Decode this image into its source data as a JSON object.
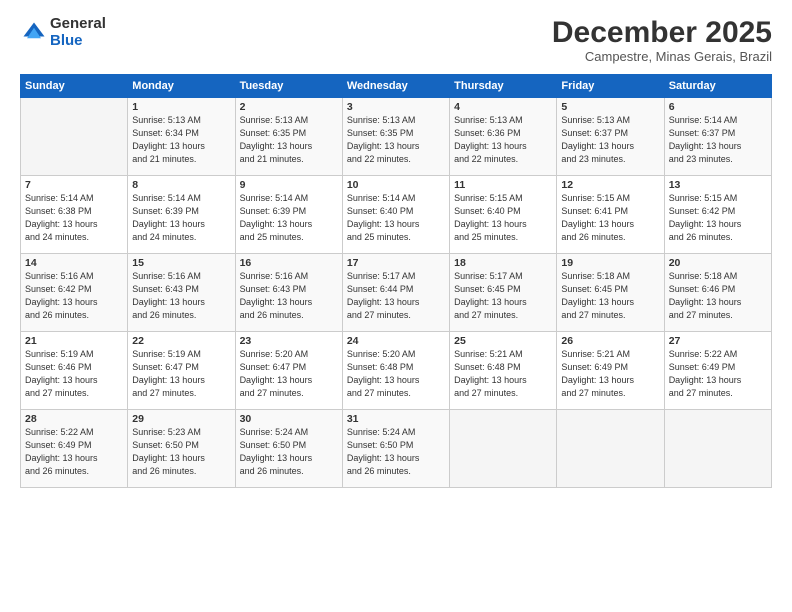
{
  "header": {
    "logo_general": "General",
    "logo_blue": "Blue",
    "month_title": "December 2025",
    "location": "Campestre, Minas Gerais, Brazil"
  },
  "days_of_week": [
    "Sunday",
    "Monday",
    "Tuesday",
    "Wednesday",
    "Thursday",
    "Friday",
    "Saturday"
  ],
  "weeks": [
    [
      {
        "day": "",
        "info": ""
      },
      {
        "day": "1",
        "info": "Sunrise: 5:13 AM\nSunset: 6:34 PM\nDaylight: 13 hours\nand 21 minutes."
      },
      {
        "day": "2",
        "info": "Sunrise: 5:13 AM\nSunset: 6:35 PM\nDaylight: 13 hours\nand 21 minutes."
      },
      {
        "day": "3",
        "info": "Sunrise: 5:13 AM\nSunset: 6:35 PM\nDaylight: 13 hours\nand 22 minutes."
      },
      {
        "day": "4",
        "info": "Sunrise: 5:13 AM\nSunset: 6:36 PM\nDaylight: 13 hours\nand 22 minutes."
      },
      {
        "day": "5",
        "info": "Sunrise: 5:13 AM\nSunset: 6:37 PM\nDaylight: 13 hours\nand 23 minutes."
      },
      {
        "day": "6",
        "info": "Sunrise: 5:14 AM\nSunset: 6:37 PM\nDaylight: 13 hours\nand 23 minutes."
      }
    ],
    [
      {
        "day": "7",
        "info": "Sunrise: 5:14 AM\nSunset: 6:38 PM\nDaylight: 13 hours\nand 24 minutes."
      },
      {
        "day": "8",
        "info": "Sunrise: 5:14 AM\nSunset: 6:39 PM\nDaylight: 13 hours\nand 24 minutes."
      },
      {
        "day": "9",
        "info": "Sunrise: 5:14 AM\nSunset: 6:39 PM\nDaylight: 13 hours\nand 25 minutes."
      },
      {
        "day": "10",
        "info": "Sunrise: 5:14 AM\nSunset: 6:40 PM\nDaylight: 13 hours\nand 25 minutes."
      },
      {
        "day": "11",
        "info": "Sunrise: 5:15 AM\nSunset: 6:40 PM\nDaylight: 13 hours\nand 25 minutes."
      },
      {
        "day": "12",
        "info": "Sunrise: 5:15 AM\nSunset: 6:41 PM\nDaylight: 13 hours\nand 26 minutes."
      },
      {
        "day": "13",
        "info": "Sunrise: 5:15 AM\nSunset: 6:42 PM\nDaylight: 13 hours\nand 26 minutes."
      }
    ],
    [
      {
        "day": "14",
        "info": "Sunrise: 5:16 AM\nSunset: 6:42 PM\nDaylight: 13 hours\nand 26 minutes."
      },
      {
        "day": "15",
        "info": "Sunrise: 5:16 AM\nSunset: 6:43 PM\nDaylight: 13 hours\nand 26 minutes."
      },
      {
        "day": "16",
        "info": "Sunrise: 5:16 AM\nSunset: 6:43 PM\nDaylight: 13 hours\nand 26 minutes."
      },
      {
        "day": "17",
        "info": "Sunrise: 5:17 AM\nSunset: 6:44 PM\nDaylight: 13 hours\nand 27 minutes."
      },
      {
        "day": "18",
        "info": "Sunrise: 5:17 AM\nSunset: 6:45 PM\nDaylight: 13 hours\nand 27 minutes."
      },
      {
        "day": "19",
        "info": "Sunrise: 5:18 AM\nSunset: 6:45 PM\nDaylight: 13 hours\nand 27 minutes."
      },
      {
        "day": "20",
        "info": "Sunrise: 5:18 AM\nSunset: 6:46 PM\nDaylight: 13 hours\nand 27 minutes."
      }
    ],
    [
      {
        "day": "21",
        "info": "Sunrise: 5:19 AM\nSunset: 6:46 PM\nDaylight: 13 hours\nand 27 minutes."
      },
      {
        "day": "22",
        "info": "Sunrise: 5:19 AM\nSunset: 6:47 PM\nDaylight: 13 hours\nand 27 minutes."
      },
      {
        "day": "23",
        "info": "Sunrise: 5:20 AM\nSunset: 6:47 PM\nDaylight: 13 hours\nand 27 minutes."
      },
      {
        "day": "24",
        "info": "Sunrise: 5:20 AM\nSunset: 6:48 PM\nDaylight: 13 hours\nand 27 minutes."
      },
      {
        "day": "25",
        "info": "Sunrise: 5:21 AM\nSunset: 6:48 PM\nDaylight: 13 hours\nand 27 minutes."
      },
      {
        "day": "26",
        "info": "Sunrise: 5:21 AM\nSunset: 6:49 PM\nDaylight: 13 hours\nand 27 minutes."
      },
      {
        "day": "27",
        "info": "Sunrise: 5:22 AM\nSunset: 6:49 PM\nDaylight: 13 hours\nand 27 minutes."
      }
    ],
    [
      {
        "day": "28",
        "info": "Sunrise: 5:22 AM\nSunset: 6:49 PM\nDaylight: 13 hours\nand 26 minutes."
      },
      {
        "day": "29",
        "info": "Sunrise: 5:23 AM\nSunset: 6:50 PM\nDaylight: 13 hours\nand 26 minutes."
      },
      {
        "day": "30",
        "info": "Sunrise: 5:24 AM\nSunset: 6:50 PM\nDaylight: 13 hours\nand 26 minutes."
      },
      {
        "day": "31",
        "info": "Sunrise: 5:24 AM\nSunset: 6:50 PM\nDaylight: 13 hours\nand 26 minutes."
      },
      {
        "day": "",
        "info": ""
      },
      {
        "day": "",
        "info": ""
      },
      {
        "day": "",
        "info": ""
      }
    ]
  ]
}
